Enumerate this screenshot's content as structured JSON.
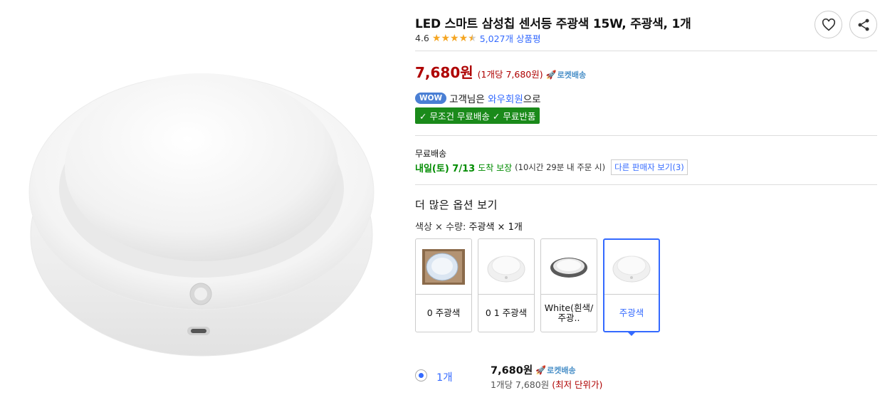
{
  "product": {
    "title": "LED 스마트 삼성칩 센서등 주광색 15W, 주광색, 1개",
    "rating_value": "4.6",
    "rating": 4.6,
    "review_count": "5,027개 상품평"
  },
  "actions": {
    "wish_icon": "heart-icon",
    "share_icon": "share-icon"
  },
  "price": {
    "amount": "7,680원",
    "unit_price": "(1개당 7,680원)",
    "rocket_label": "로켓배송"
  },
  "wow": {
    "badge": "WOW",
    "prefix": "고객님은",
    "link": "와우회원",
    "suffix": "으로",
    "benefit": "✓ 무조건 무료배송 ✓ 무료반품"
  },
  "shipping": {
    "label": "무료배송",
    "date": "내일(토) 7/13",
    "guarantee": "도착 보장",
    "note": "(10시간 29분 내 주문 시)",
    "other_seller": "다른 판매자 보기(3)"
  },
  "options": {
    "heading": "더 많은 옵션 보기",
    "color_label": "색상 × 수량:",
    "selected_value": "주광색 × 1개",
    "cards": [
      {
        "label": "0 주광색"
      },
      {
        "label": "0 1 주광색"
      },
      {
        "label": "White(흰색/주광.."
      },
      {
        "label": "주광색"
      }
    ]
  },
  "quantity": {
    "label": "1개",
    "price": "7,680원",
    "rocket_label": "로켓배송",
    "unit_prefix": "1개당 7,680원",
    "lowest": "(최저 단위가)"
  },
  "colors": {
    "accent": "#346aff",
    "price_red": "#ae0000",
    "green": "#1a8a1a"
  }
}
